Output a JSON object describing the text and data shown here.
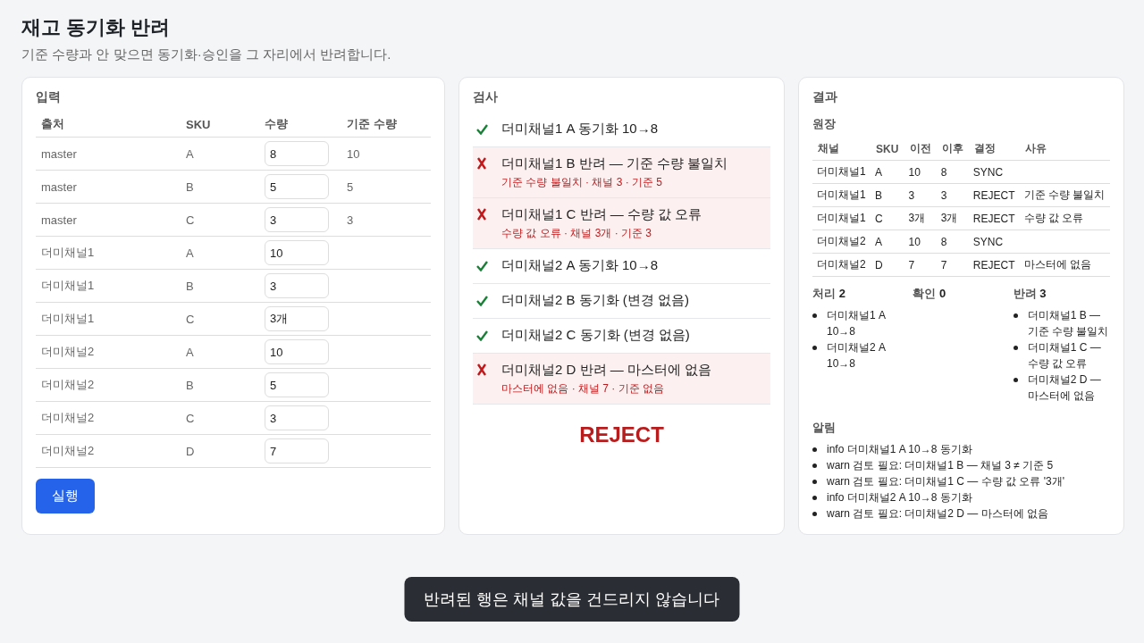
{
  "page": {
    "title": "재고 동기화 반려",
    "subtitle": "기준 수량과 안 맞으면 동기화·승인을 그 자리에서 반려합니다."
  },
  "input": {
    "title": "입력",
    "columns": [
      "출처",
      "SKU",
      "수량",
      "기준 수량"
    ],
    "rows": [
      {
        "source": "master",
        "sku": "A",
        "qty": "8",
        "base": "10"
      },
      {
        "source": "master",
        "sku": "B",
        "qty": "5",
        "base": "5"
      },
      {
        "source": "master",
        "sku": "C",
        "qty": "3",
        "base": "3"
      },
      {
        "source": "더미채널1",
        "sku": "A",
        "qty": "10"
      },
      {
        "source": "더미채널1",
        "sku": "B",
        "qty": "3"
      },
      {
        "source": "더미채널1",
        "sku": "C",
        "qty": "3개"
      },
      {
        "source": "더미채널2",
        "sku": "A",
        "qty": "10"
      },
      {
        "source": "더미채널2",
        "sku": "B",
        "qty": "5"
      },
      {
        "source": "더미채널2",
        "sku": "C",
        "qty": "3"
      },
      {
        "source": "더미채널2",
        "sku": "D",
        "qty": "7"
      }
    ],
    "run_button": "실행"
  },
  "checks": {
    "title": "검사",
    "items": [
      {
        "rejected": false,
        "text": "더미채널1 A 동기화 10→8"
      },
      {
        "rejected": true,
        "text": "더미채널1 B 반려 — 기준 수량 불일치",
        "detail": "기준 수량 불일치 · 채널 3 · 기준 5"
      },
      {
        "rejected": true,
        "text": "더미채널1 C 반려 — 수량 값 오류",
        "detail": "수량 값 오류 · 채널 3개 · 기준 3"
      },
      {
        "rejected": false,
        "text": "더미채널2 A 동기화 10→8"
      },
      {
        "rejected": false,
        "text": "더미채널2 B 동기화 (변경 없음)"
      },
      {
        "rejected": false,
        "text": "더미채널2 C 동기화 (변경 없음)"
      },
      {
        "rejected": true,
        "text": "더미채널2 D 반려 — 마스터에 없음",
        "detail": "마스터에 없음 · 채널 7 · 기준 없음"
      }
    ],
    "verdict": "REJECT"
  },
  "result": {
    "title": "결과",
    "ledger_title": "원장",
    "columns": [
      "채널",
      "SKU",
      "이전",
      "이후",
      "결정",
      "사유"
    ],
    "rows": [
      [
        "더미채널1",
        "A",
        "10",
        "8",
        "SYNC",
        ""
      ],
      [
        "더미채널1",
        "B",
        "3",
        "3",
        "REJECT",
        "기준 수량 불일치"
      ],
      [
        "더미채널1",
        "C",
        "3개",
        "3개",
        "REJECT",
        "수량 값 오류"
      ],
      [
        "더미채널2",
        "A",
        "10",
        "8",
        "SYNC",
        ""
      ],
      [
        "더미채널2",
        "D",
        "7",
        "7",
        "REJECT",
        "마스터에 없음"
      ]
    ],
    "groups": [
      {
        "label": "처리",
        "count": "2",
        "items": [
          "더미채널1 A 10→8",
          "더미채널2 A 10→8"
        ]
      },
      {
        "label": "확인",
        "count": "0"
      },
      {
        "label": "반려",
        "count": "3",
        "items": [
          "더미채널1 B — 기준 수량 불일치",
          "더미채널1 C — 수량 값 오류",
          "더미채널2 D — 마스터에 없음"
        ]
      }
    ],
    "alerts_title": "알림",
    "alerts": [
      "info 더미채널1 A 10→8 동기화",
      "warn 검토 필요: 더미채널1 B — 채널 3 ≠ 기준 5",
      "warn 검토 필요: 더미채널1 C — 수량 값 오류 '3개'",
      "info 더미채널2 A 10→8 동기화",
      "warn 검토 필요: 더미채널2 D — 마스터에 없음"
    ]
  },
  "toast": "반려된 행은 채널 값을 건드리지 않습니다"
}
